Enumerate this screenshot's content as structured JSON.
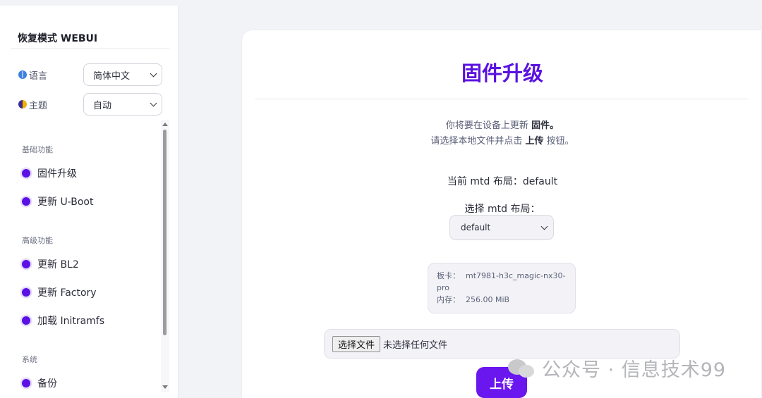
{
  "sidebar": {
    "brand": "恢复模式 WEBUI",
    "language": {
      "label": "语言",
      "value": "简体中文"
    },
    "theme": {
      "label": "主题",
      "value": "自动"
    },
    "groups": [
      {
        "label": "基础功能",
        "items": [
          "固件升级",
          "更新 U-Boot"
        ]
      },
      {
        "label": "高级功能",
        "items": [
          "更新 BL2",
          "更新 Factory",
          "加载 Initramfs"
        ]
      },
      {
        "label": "系统",
        "items": [
          "备份"
        ]
      }
    ]
  },
  "main": {
    "title": "固件升级",
    "intro_line1_pre": "你将要在设备上更新 ",
    "intro_line1_bold": "固件。",
    "intro_line2_pre": "请选择本地文件并点击 ",
    "intro_line2_bold": "上传",
    "intro_line2_post": " 按钮。",
    "current_layout": "当前 mtd 布局：default",
    "select_layout_label": "选择 mtd 布局：",
    "select_layout_value": "default",
    "board_key": "板卡：",
    "board_value": "mt7981-h3c_magic-nx30-pro",
    "memory_key": "内存：",
    "memory_value": "256.00 MiB",
    "file_button": "选择文件",
    "file_status": "未选择任何文件",
    "upload_button": "上传"
  },
  "watermark": "公众号 · 信息技术99",
  "colors": {
    "accent": "#5a12e0",
    "button": "#6a16ef"
  }
}
